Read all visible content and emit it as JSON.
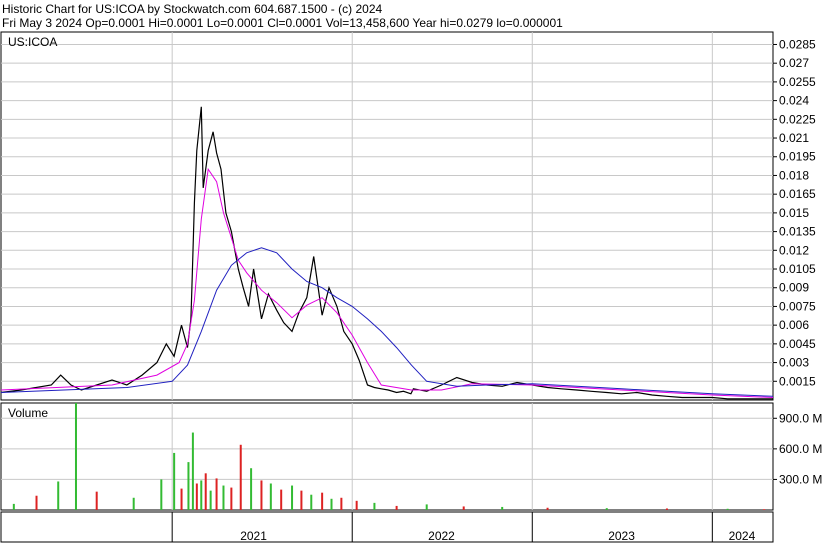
{
  "header": {
    "line1": "Historic Chart for US:ICOA by Stockwatch.com 604.687.1500 - (c) 2024",
    "line2": "Fri May  3 2024   Op=0.0001   Hi=0.0001   Lo=0.0001   Cl=0.0001   Vol=13,458,600   Year hi=0.0279   lo=0.000001"
  },
  "colors": {
    "price": "#000000",
    "ma_short": "#e000e0",
    "ma_long": "#2020c0",
    "vol_up": "#33bb33",
    "vol_down": "#dd2222",
    "grid": "#c8c8c8"
  },
  "chart_data": [
    {
      "type": "line",
      "title": "US:ICOA",
      "ylim": [
        0,
        0.0295
      ],
      "y_ticks": [
        "0.0285",
        "0.027",
        "0.0255",
        "0.024",
        "0.0225",
        "0.021",
        "0.0195",
        "0.018",
        "0.0165",
        "0.015",
        "0.0135",
        "0.012",
        "0.0105",
        "0.009",
        "0.0075",
        "0.006",
        "0.0045",
        "0.003",
        "0.0015"
      ],
      "y_tick_values": [
        0.0285,
        0.027,
        0.0255,
        0.024,
        0.0225,
        0.021,
        0.0195,
        0.018,
        0.0165,
        0.015,
        0.0135,
        0.012,
        0.0105,
        0.009,
        0.0075,
        0.006,
        0.0045,
        0.003,
        0.0015
      ],
      "x_labels": [
        "2021",
        "2022",
        "2023",
        "2024"
      ],
      "x_label_dates": [
        "2021-06-15",
        "2022-07-01",
        "2023-07-01",
        "2024-03-01"
      ],
      "year_boundaries": [
        "2021-01-01",
        "2022-01-01",
        "2023-01-01",
        "2024-01-01"
      ],
      "x_range": [
        "2020-01-20",
        "2024-05-03"
      ],
      "grid": true,
      "series": [
        {
          "role": "price",
          "x": [
            "2020-01-20",
            "2020-03-01",
            "2020-05-01",
            "2020-05-20",
            "2020-06-10",
            "2020-07-01",
            "2020-08-01",
            "2020-09-01",
            "2020-10-01",
            "2020-11-01",
            "2020-12-01",
            "2020-12-20",
            "2021-01-05",
            "2021-01-20",
            "2021-02-01",
            "2021-02-08",
            "2021-02-10",
            "2021-02-15",
            "2021-02-20",
            "2021-03-01",
            "2021-03-05",
            "2021-03-15",
            "2021-03-25",
            "2021-04-01",
            "2021-04-10",
            "2021-04-20",
            "2021-05-01",
            "2021-05-15",
            "2021-05-25",
            "2021-06-05",
            "2021-06-15",
            "2021-07-01",
            "2021-07-15",
            "2021-08-01",
            "2021-08-15",
            "2021-09-01",
            "2021-09-15",
            "2021-10-01",
            "2021-10-15",
            "2021-11-01",
            "2021-11-15",
            "2021-12-01",
            "2021-12-15",
            "2022-01-01",
            "2022-01-15",
            "2022-02-01",
            "2022-02-15",
            "2022-03-01",
            "2022-03-15",
            "2022-04-01",
            "2022-04-15",
            "2022-04-30",
            "2022-05-05",
            "2022-06-01",
            "2022-07-01",
            "2022-08-01",
            "2022-09-01",
            "2022-10-01",
            "2022-11-01",
            "2022-12-01",
            "2023-01-01",
            "2023-02-01",
            "2023-03-01",
            "2023-04-01",
            "2023-05-01",
            "2023-06-01",
            "2023-07-01",
            "2023-08-01",
            "2023-09-01",
            "2023-10-01",
            "2023-11-01",
            "2023-12-01",
            "2024-01-01",
            "2024-02-01",
            "2024-03-01",
            "2024-04-01",
            "2024-05-03"
          ],
          "y": [
            0.0006,
            0.0008,
            0.0012,
            0.002,
            0.0012,
            0.0008,
            0.0012,
            0.0016,
            0.0012,
            0.002,
            0.003,
            0.0045,
            0.0035,
            0.006,
            0.0042,
            0.0065,
            0.009,
            0.0158,
            0.02,
            0.0235,
            0.017,
            0.02,
            0.0215,
            0.0198,
            0.0185,
            0.015,
            0.0135,
            0.0105,
            0.009,
            0.0075,
            0.0105,
            0.0065,
            0.0085,
            0.0072,
            0.0062,
            0.0055,
            0.007,
            0.0082,
            0.0115,
            0.0068,
            0.009,
            0.0075,
            0.0055,
            0.0045,
            0.0032,
            0.0012,
            0.001,
            0.0009,
            0.0008,
            0.0006,
            0.0007,
            0.0005,
            0.0009,
            0.0007,
            0.0012,
            0.0018,
            0.0014,
            0.0012,
            0.0011,
            0.0014,
            0.0012,
            0.001,
            0.0009,
            0.0008,
            0.0007,
            0.0006,
            0.0005,
            0.0006,
            0.0004,
            0.0003,
            0.0002,
            0.0002,
            0.0002,
            0.0001,
            0.0001,
            0.0001,
            0.0001
          ]
        },
        {
          "role": "ma_short",
          "x": [
            "2020-01-20",
            "2020-09-01",
            "2020-12-01",
            "2021-01-15",
            "2021-02-01",
            "2021-02-15",
            "2021-03-01",
            "2021-03-15",
            "2021-04-01",
            "2021-04-15",
            "2021-05-01",
            "2021-05-15",
            "2021-06-01",
            "2021-07-01",
            "2021-08-01",
            "2021-09-01",
            "2021-10-01",
            "2021-11-01",
            "2021-12-01",
            "2022-01-01",
            "2022-02-01",
            "2022-03-01",
            "2022-05-01",
            "2022-07-01",
            "2022-09-01",
            "2023-01-01",
            "2023-07-01",
            "2024-01-01",
            "2024-05-03"
          ],
          "y": [
            0.0008,
            0.0012,
            0.002,
            0.003,
            0.0045,
            0.008,
            0.0145,
            0.0185,
            0.0175,
            0.015,
            0.013,
            0.0112,
            0.0102,
            0.0088,
            0.0078,
            0.0066,
            0.0076,
            0.0082,
            0.007,
            0.0052,
            0.003,
            0.0012,
            0.0008,
            0.0008,
            0.0013,
            0.0012,
            0.0008,
            0.0004,
            0.0002
          ]
        },
        {
          "role": "ma_long",
          "x": [
            "2020-01-20",
            "2020-10-01",
            "2021-01-01",
            "2021-02-01",
            "2021-03-01",
            "2021-04-01",
            "2021-05-01",
            "2021-06-01",
            "2021-07-01",
            "2021-08-01",
            "2021-09-01",
            "2021-10-01",
            "2021-11-01",
            "2021-12-01",
            "2022-01-01",
            "2022-02-01",
            "2022-03-01",
            "2022-04-01",
            "2022-05-01",
            "2022-06-01",
            "2022-08-01",
            "2022-10-01",
            "2023-01-01",
            "2023-07-01",
            "2024-01-01",
            "2024-05-03"
          ],
          "y": [
            0.0006,
            0.001,
            0.0015,
            0.0028,
            0.0055,
            0.0088,
            0.0108,
            0.0118,
            0.0122,
            0.0118,
            0.0105,
            0.0095,
            0.009,
            0.0082,
            0.0075,
            0.0065,
            0.0055,
            0.0042,
            0.0028,
            0.0015,
            0.0011,
            0.0012,
            0.0013,
            0.0009,
            0.0005,
            0.0003
          ]
        }
      ]
    },
    {
      "type": "bar",
      "title": "Volume",
      "ylim": [
        0,
        1050
      ],
      "y_ticks": [
        "900.0 M",
        "600.0 M",
        "300.0 M"
      ],
      "y_tick_values": [
        900,
        600,
        300
      ],
      "series": [
        {
          "name": "Volume",
          "x": [
            "2020-02-15",
            "2020-04-01",
            "2020-05-15",
            "2020-06-20",
            "2020-08-01",
            "2020-10-15",
            "2020-12-10",
            "2021-01-05",
            "2021-01-20",
            "2021-02-03",
            "2021-02-12",
            "2021-02-20",
            "2021-03-01",
            "2021-03-10",
            "2021-03-20",
            "2021-04-01",
            "2021-04-15",
            "2021-05-01",
            "2021-05-20",
            "2021-06-10",
            "2021-07-01",
            "2021-07-20",
            "2021-08-10",
            "2021-09-01",
            "2021-09-20",
            "2021-10-10",
            "2021-11-01",
            "2021-11-20",
            "2021-12-10",
            "2022-01-10",
            "2022-02-15",
            "2022-04-01",
            "2022-06-01",
            "2022-08-15",
            "2022-11-01",
            "2023-02-01",
            "2023-06-01",
            "2023-10-01",
            "2024-02-01",
            "2024-04-15"
          ],
          "values": [
            60,
            140,
            280,
            1050,
            180,
            120,
            300,
            560,
            210,
            470,
            760,
            260,
            290,
            360,
            190,
            310,
            240,
            220,
            640,
            410,
            290,
            260,
            200,
            240,
            190,
            150,
            170,
            110,
            120,
            90,
            70,
            40,
            55,
            35,
            30,
            22,
            18,
            15,
            12,
            8
          ],
          "direction": [
            "up",
            "down",
            "up",
            "up",
            "down",
            "up",
            "up",
            "up",
            "down",
            "up",
            "up",
            "down",
            "up",
            "down",
            "up",
            "down",
            "up",
            "down",
            "down",
            "up",
            "down",
            "up",
            "down",
            "up",
            "down",
            "up",
            "down",
            "up",
            "down",
            "down",
            "up",
            "down",
            "up",
            "down",
            "up",
            "down",
            "up",
            "down",
            "up",
            "down"
          ]
        }
      ]
    }
  ]
}
